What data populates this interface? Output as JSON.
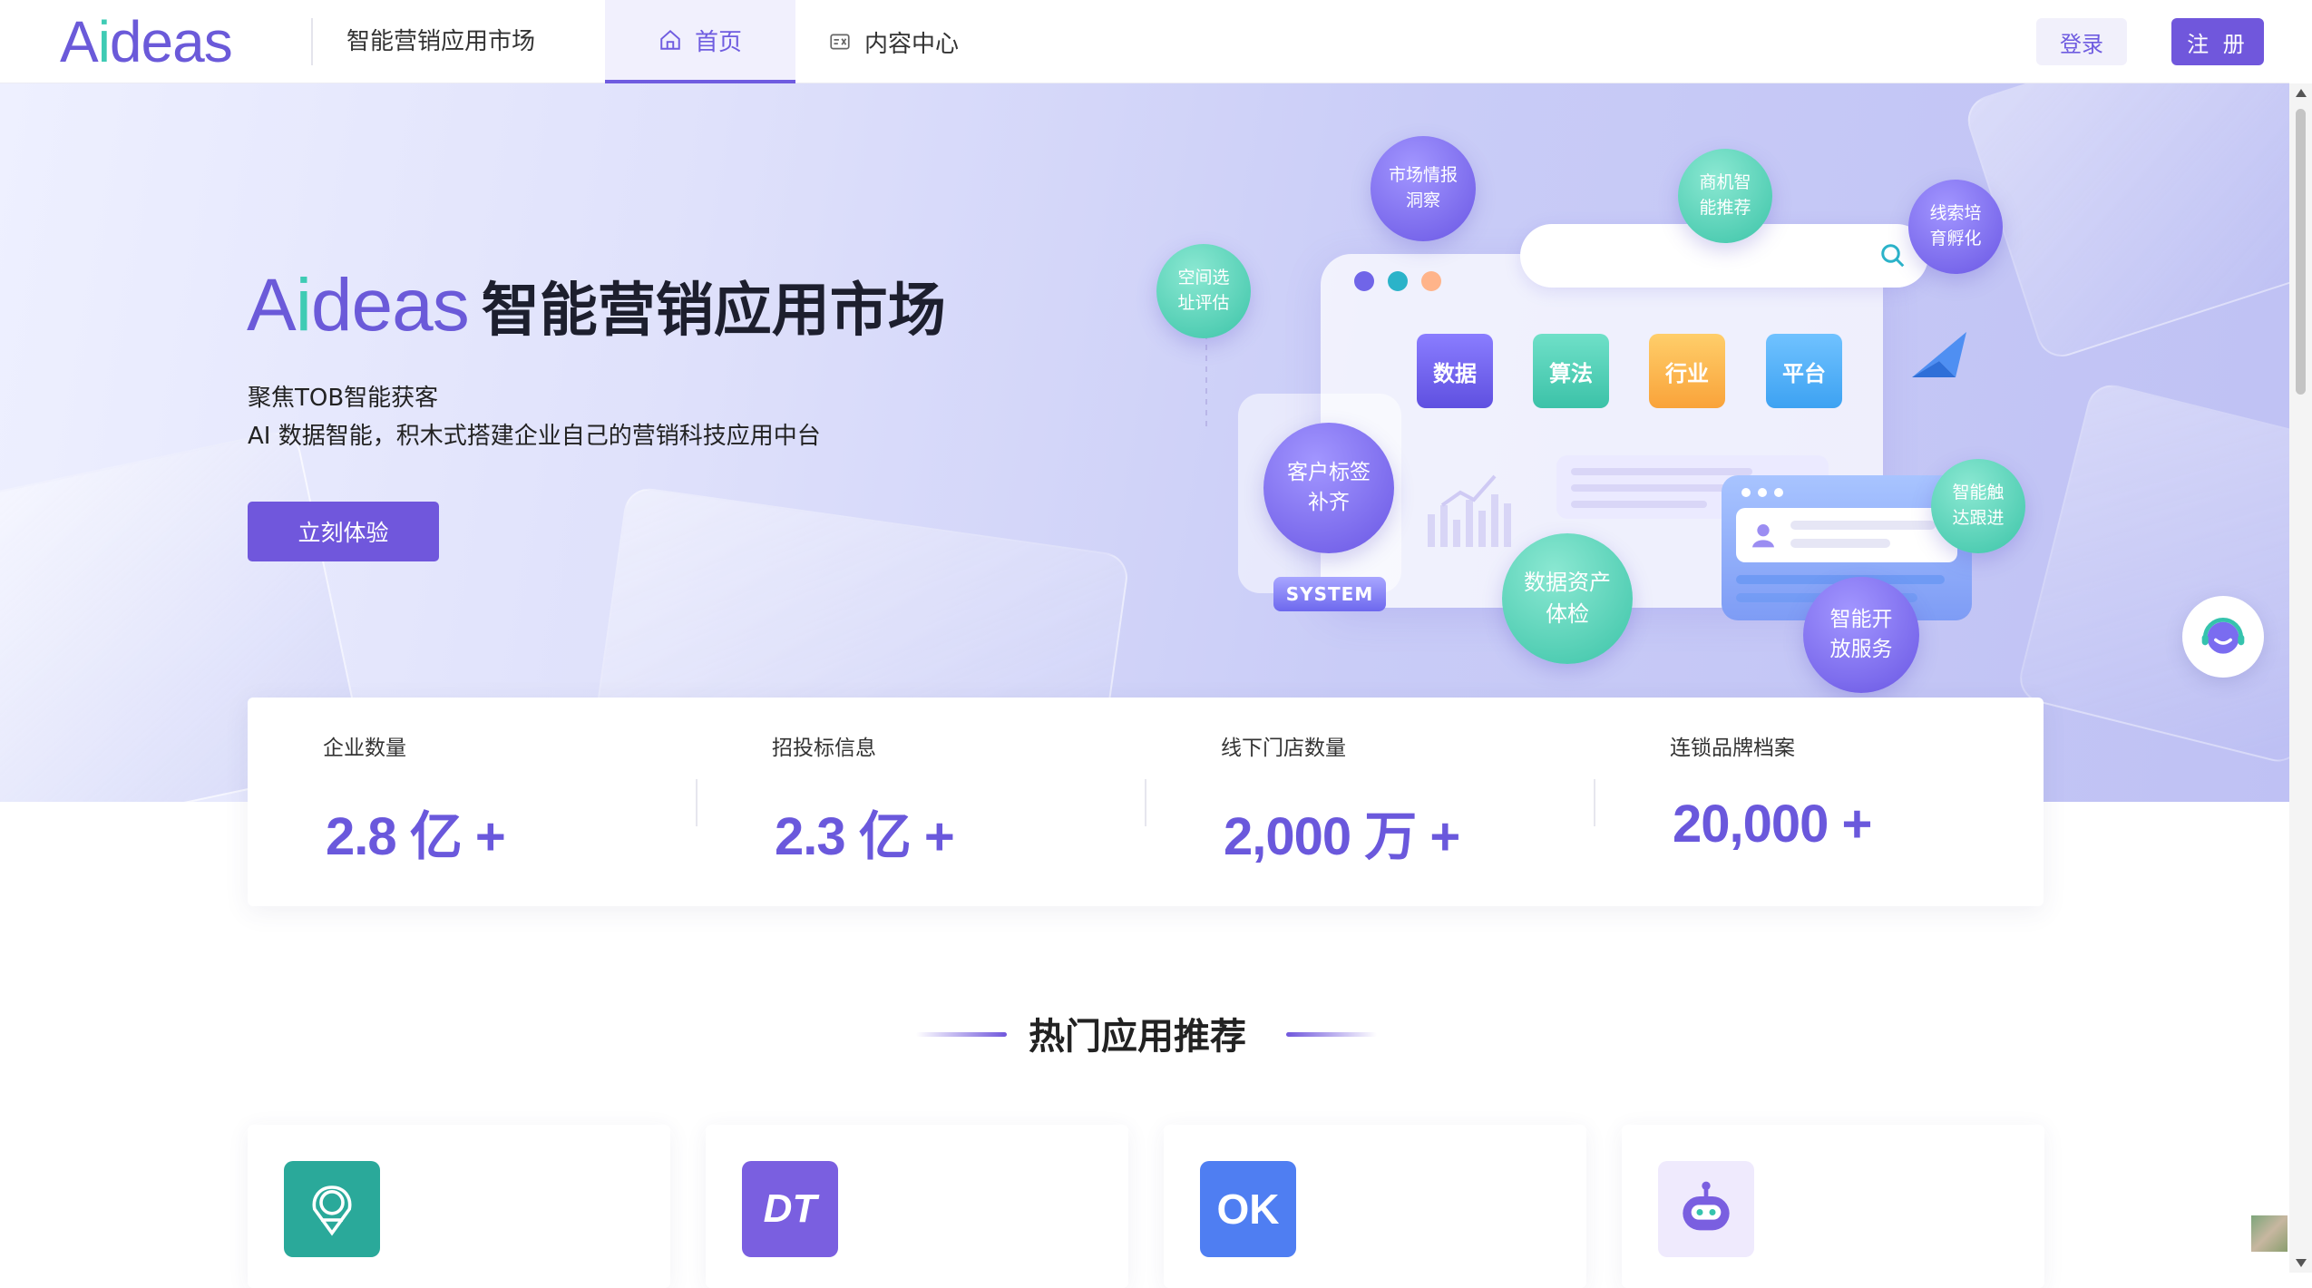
{
  "header": {
    "logo_prefix": "A",
    "logo_i": "i",
    "logo_suffix": "deas",
    "site_name": "智能营销应用市场",
    "nav": [
      {
        "label": "首页",
        "icon": "home-icon",
        "active": true
      },
      {
        "label": "内容中心",
        "icon": "content-center-icon",
        "active": false
      }
    ],
    "login_label": "登录",
    "register_label": "注 册"
  },
  "hero": {
    "brand_prefix": "A",
    "brand_i": "i",
    "brand_suffix": "deas",
    "title": "智能营销应用市场",
    "subtitle_1": "聚焦TOB智能获客",
    "subtitle_2": "AI 数据智能，积木式搭建企业自己的营销科技应用中台",
    "cta_label": "立刻体验",
    "illustration": {
      "tiles": [
        "数据",
        "算法",
        "行业",
        "平台"
      ],
      "system_label": "SYSTEM",
      "bubbles": [
        "空间选址评估",
        "市场情报洞察",
        "商机智能推荐",
        "线索培育孵化",
        "客户标签补齐",
        "智能触达跟进",
        "数据资产体检",
        "智能开放服务"
      ]
    }
  },
  "stats": [
    {
      "label": "企业数量",
      "value": "2.8 亿 +"
    },
    {
      "label": "招投标信息",
      "value": "2.3 亿 +"
    },
    {
      "label": "线下门店数量",
      "value": "2,000 万 +"
    },
    {
      "label": "连锁品牌档案",
      "value": "20,000 +"
    }
  ],
  "section": {
    "title": "热门应用推荐",
    "apps": [
      {
        "icon": "location-pin-app-icon",
        "color": "#2aa99a"
      },
      {
        "icon": "dt-app-icon",
        "color": "#7a5fe0",
        "text": "DT"
      },
      {
        "icon": "ok-app-icon",
        "color": "#4f7ef2",
        "text": "OK"
      },
      {
        "icon": "robot-app-icon",
        "color": "#efeafd"
      }
    ]
  },
  "colors": {
    "brand": "#7057dc",
    "accent": "#3ecbb4",
    "stat_value": "#6a58dc"
  }
}
